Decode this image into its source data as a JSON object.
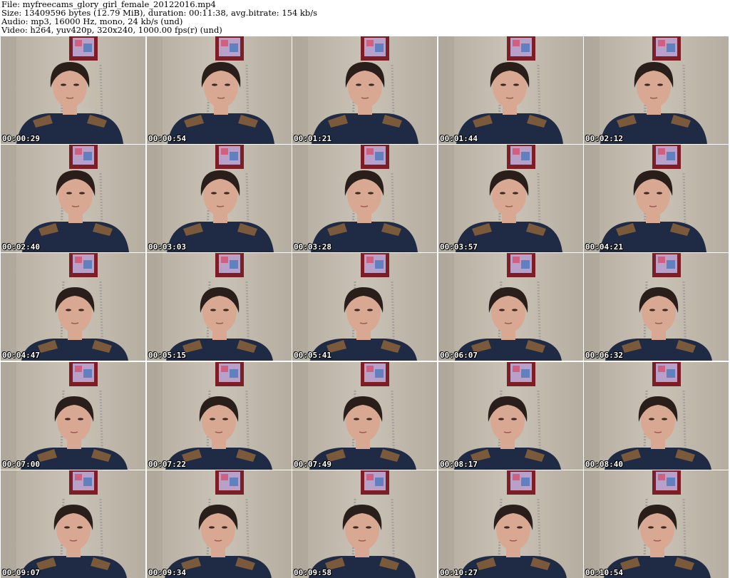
{
  "header": {
    "file_line": "File: myfreecams_glory_girl_female_20122016.mp4",
    "size_line": "Size: 13409596 bytes (12.79 MiB), duration: 00:11:38, avg.bitrate: 154 kb/s",
    "audio_line": "Audio: mp3, 16000 Hz, mono, 24 kb/s (und)",
    "video_line": "Video: h264, yuv420p, 320x240, 1000.00 fps(r) (und)"
  },
  "thumbnails": [
    {
      "timestamp": "00:00:29"
    },
    {
      "timestamp": "00:00:54"
    },
    {
      "timestamp": "00:01:21"
    },
    {
      "timestamp": "00:01:44"
    },
    {
      "timestamp": "00:02:12"
    },
    {
      "timestamp": "00:02:40"
    },
    {
      "timestamp": "00:03:03"
    },
    {
      "timestamp": "00:03:28"
    },
    {
      "timestamp": "00:03:57"
    },
    {
      "timestamp": "00:04:21"
    },
    {
      "timestamp": "00:04:47"
    },
    {
      "timestamp": "00:05:15"
    },
    {
      "timestamp": "00:05:41"
    },
    {
      "timestamp": "00:06:07"
    },
    {
      "timestamp": "00:06:32"
    },
    {
      "timestamp": "00:07:00"
    },
    {
      "timestamp": "00:07:22"
    },
    {
      "timestamp": "00:07:49"
    },
    {
      "timestamp": "00:08:17"
    },
    {
      "timestamp": "00:08:40"
    },
    {
      "timestamp": "00:09:07"
    },
    {
      "timestamp": "00:09:34"
    },
    {
      "timestamp": "00:09:58"
    },
    {
      "timestamp": "00:10:27"
    },
    {
      "timestamp": "00:10:54"
    }
  ],
  "colors": {
    "wall": "#c9c2b6",
    "wall_shadow": "#b5ad9f",
    "sweater": "#1f2a44",
    "shoulder_patch": "#7a5a3a",
    "hair": "#2a1e1a",
    "skin": "#d8a892",
    "picture_frame": "#7d1e26"
  }
}
